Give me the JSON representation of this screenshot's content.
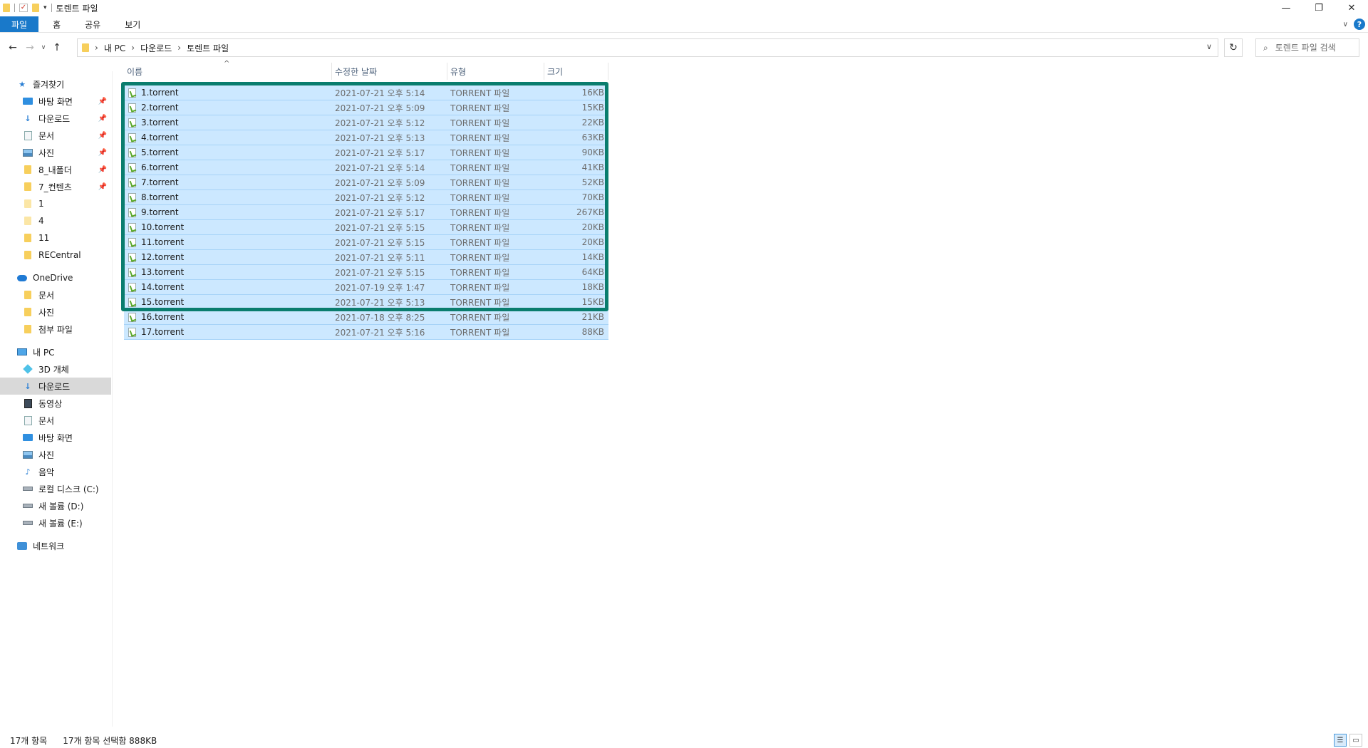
{
  "window": {
    "title": "토렌트 파일",
    "controls": {
      "minimize": "—",
      "maximize": "❐",
      "close": "✕"
    }
  },
  "ribbon": {
    "tabs": [
      "파일",
      "홈",
      "공유",
      "보기"
    ],
    "help": "?"
  },
  "address": {
    "breadcrumbs": [
      "내 PC",
      "다운로드",
      "토렌트 파일"
    ],
    "search_placeholder": "토렌트 파일 검색"
  },
  "sidebar": {
    "quick_access": {
      "label": "즐겨찾기",
      "items": [
        {
          "label": "바탕 화면",
          "icon": "desktop-icon",
          "pinned": true
        },
        {
          "label": "다운로드",
          "icon": "download-icon",
          "pinned": true
        },
        {
          "label": "문서",
          "icon": "document-icon",
          "pinned": true
        },
        {
          "label": "사진",
          "icon": "pictures-icon",
          "pinned": true
        },
        {
          "label": "8_내폴더",
          "icon": "folder-icon",
          "pinned": true
        },
        {
          "label": "7_컨텐츠",
          "icon": "folder-icon",
          "pinned": true
        },
        {
          "label": "1",
          "icon": "folder-icon",
          "pinned": false
        },
        {
          "label": "4",
          "icon": "folder-icon",
          "pinned": false
        },
        {
          "label": "11",
          "icon": "folder-icon",
          "pinned": false
        },
        {
          "label": "RECentral",
          "icon": "folder-icon",
          "pinned": false
        }
      ]
    },
    "onedrive": {
      "label": "OneDrive",
      "items": [
        {
          "label": "문서",
          "icon": "folder-icon"
        },
        {
          "label": "사진",
          "icon": "folder-icon"
        },
        {
          "label": "첨부 파일",
          "icon": "folder-icon"
        }
      ]
    },
    "this_pc": {
      "label": "내 PC",
      "items": [
        {
          "label": "3D 개체",
          "icon": "3d-objects-icon"
        },
        {
          "label": "다운로드",
          "icon": "download-icon",
          "selected": true
        },
        {
          "label": "동영상",
          "icon": "video-icon"
        },
        {
          "label": "문서",
          "icon": "document-icon"
        },
        {
          "label": "바탕 화면",
          "icon": "desktop-icon"
        },
        {
          "label": "사진",
          "icon": "pictures-icon"
        },
        {
          "label": "음악",
          "icon": "music-icon"
        },
        {
          "label": "로컬 디스크 (C:)",
          "icon": "drive-icon"
        },
        {
          "label": "새 볼륨 (D:)",
          "icon": "drive-icon"
        },
        {
          "label": "새 볼륨 (E:)",
          "icon": "drive-icon"
        }
      ]
    },
    "network": {
      "label": "네트워크"
    }
  },
  "files": {
    "columns": {
      "name": "이름",
      "date": "수정한 날짜",
      "type": "유형",
      "size": "크기"
    },
    "rows": [
      {
        "name": "1.torrent",
        "date": "2021-07-21 오후 5:14",
        "type": "TORRENT 파일",
        "size": "16KB"
      },
      {
        "name": "2.torrent",
        "date": "2021-07-21 오후 5:09",
        "type": "TORRENT 파일",
        "size": "15KB"
      },
      {
        "name": "3.torrent",
        "date": "2021-07-21 오후 5:12",
        "type": "TORRENT 파일",
        "size": "22KB"
      },
      {
        "name": "4.torrent",
        "date": "2021-07-21 오후 5:13",
        "type": "TORRENT 파일",
        "size": "63KB"
      },
      {
        "name": "5.torrent",
        "date": "2021-07-21 오후 5:17",
        "type": "TORRENT 파일",
        "size": "90KB"
      },
      {
        "name": "6.torrent",
        "date": "2021-07-21 오후 5:14",
        "type": "TORRENT 파일",
        "size": "41KB"
      },
      {
        "name": "7.torrent",
        "date": "2021-07-21 오후 5:09",
        "type": "TORRENT 파일",
        "size": "52KB"
      },
      {
        "name": "8.torrent",
        "date": "2021-07-21 오후 5:12",
        "type": "TORRENT 파일",
        "size": "70KB"
      },
      {
        "name": "9.torrent",
        "date": "2021-07-21 오후 5:17",
        "type": "TORRENT 파일",
        "size": "267KB"
      },
      {
        "name": "10.torrent",
        "date": "2021-07-21 오후 5:15",
        "type": "TORRENT 파일",
        "size": "20KB"
      },
      {
        "name": "11.torrent",
        "date": "2021-07-21 오후 5:15",
        "type": "TORRENT 파일",
        "size": "20KB"
      },
      {
        "name": "12.torrent",
        "date": "2021-07-21 오후 5:11",
        "type": "TORRENT 파일",
        "size": "14KB"
      },
      {
        "name": "13.torrent",
        "date": "2021-07-21 오후 5:15",
        "type": "TORRENT 파일",
        "size": "64KB"
      },
      {
        "name": "14.torrent",
        "date": "2021-07-19 오후 1:47",
        "type": "TORRENT 파일",
        "size": "18KB"
      },
      {
        "name": "15.torrent",
        "date": "2021-07-21 오후 5:13",
        "type": "TORRENT 파일",
        "size": "15KB"
      },
      {
        "name": "16.torrent",
        "date": "2021-07-18 오후 8:25",
        "type": "TORRENT 파일",
        "size": "21KB"
      },
      {
        "name": "17.torrent",
        "date": "2021-07-21 오후 5:16",
        "type": "TORRENT 파일",
        "size": "88KB"
      }
    ]
  },
  "status": {
    "item_count": "17개 항목",
    "selection": "17개 항목 선택함 888KB"
  },
  "colors": {
    "accent": "#1979ca",
    "selection": "#cce8ff",
    "highlight_border": "#0a7d6e"
  }
}
